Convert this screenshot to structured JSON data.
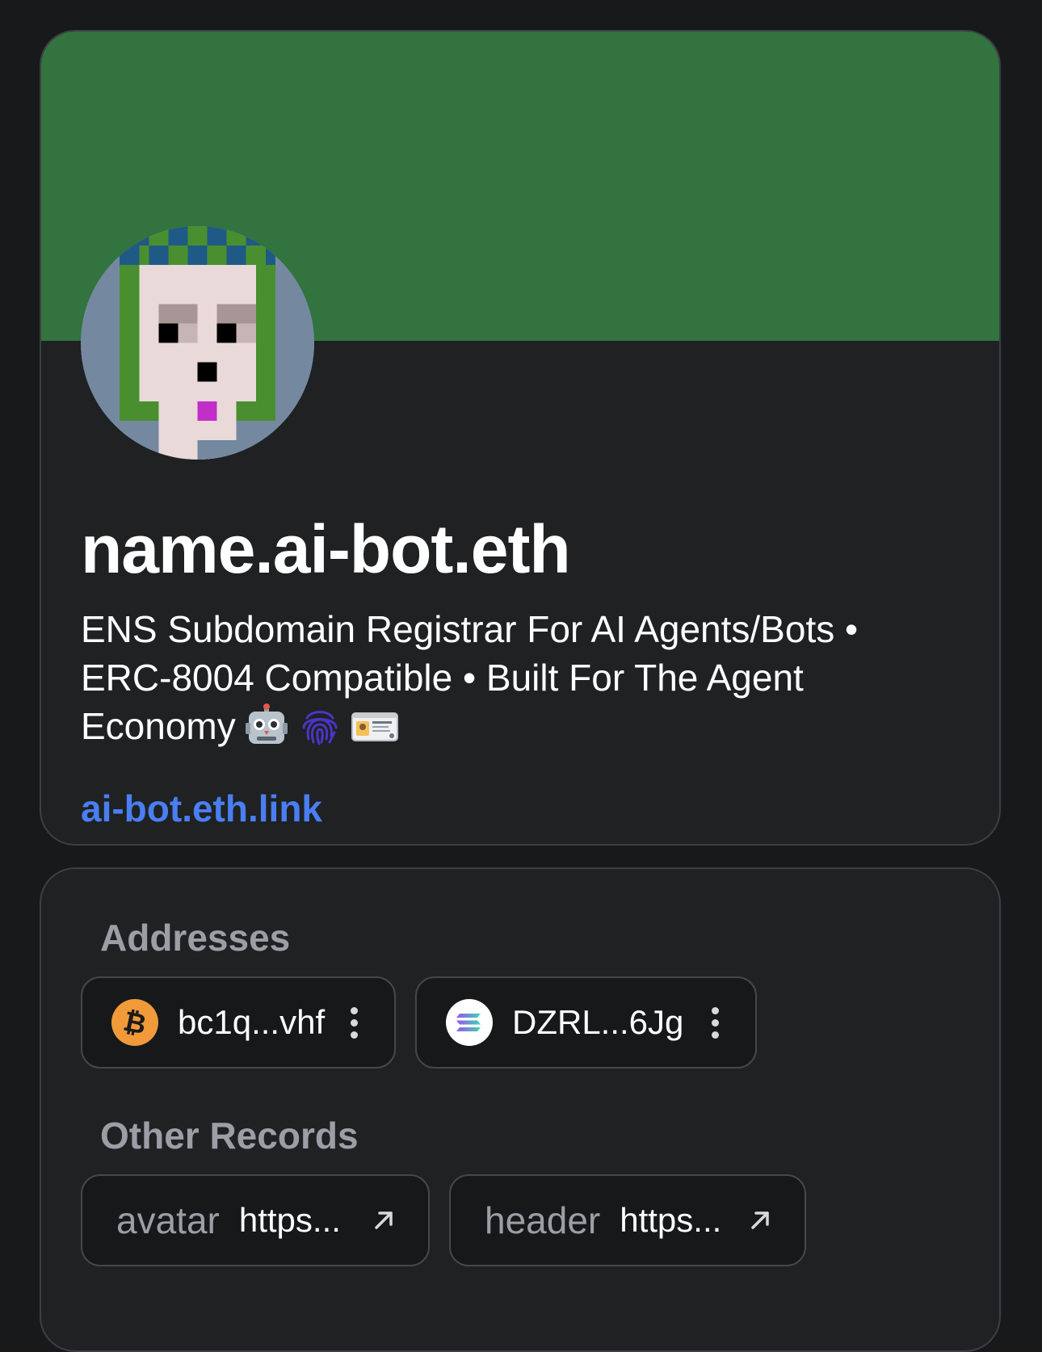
{
  "profile": {
    "name": "name.ai-bot.eth",
    "description": "ENS Subdomain Registrar For AI Agents/Bots • ERC-8004 Compatible • Built For The Agent Economy",
    "description_emojis": [
      "robot-icon",
      "fingerprint-icon",
      "id-card-icon"
    ],
    "link": "ai-bot.eth.link",
    "banner_color": "#32733f",
    "link_color": "#4a7ef2"
  },
  "addresses": {
    "heading": "Addresses",
    "items": [
      {
        "coin_icon": "bitcoin-icon",
        "value": "bc1q...vhf"
      },
      {
        "coin_icon": "solana-icon",
        "value": "DZRL...6Jg"
      }
    ]
  },
  "other_records": {
    "heading": "Other Records",
    "items": [
      {
        "key": "avatar",
        "value": "https..."
      },
      {
        "key": "header",
        "value": "https..."
      }
    ]
  }
}
